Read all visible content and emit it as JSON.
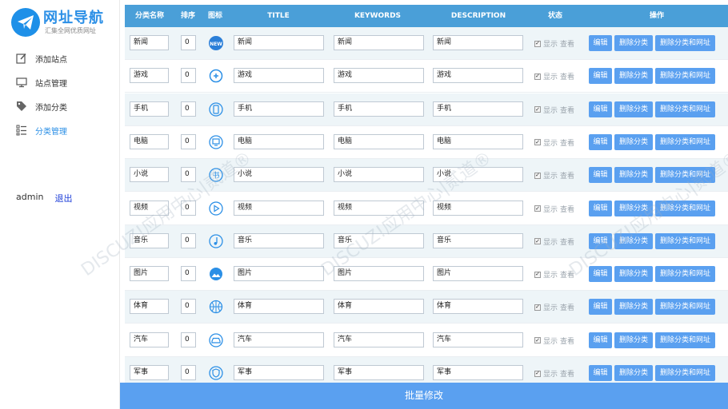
{
  "logo": {
    "title": "网址导航",
    "subtitle": "汇集全网优质网址"
  },
  "menu": [
    {
      "label": "添加站点",
      "icon": "edit-icon"
    },
    {
      "label": "站点管理",
      "icon": "monitor-icon"
    },
    {
      "label": "添加分类",
      "icon": "tag-icon"
    },
    {
      "label": "分类管理",
      "icon": "list-icon"
    }
  ],
  "user": {
    "name": "admin",
    "logout": "退出"
  },
  "table": {
    "headers": [
      "分类名称",
      "排序",
      "图标",
      "TITLE",
      "KEYWORDS",
      "DESCRIPTION",
      "状态",
      "操作"
    ],
    "rows": [
      {
        "name": "新闻",
        "sort": "0",
        "icon": "news-icon",
        "title": "新闻",
        "keywords": "新闻",
        "description": "新闻"
      },
      {
        "name": "游戏",
        "sort": "0",
        "icon": "game-icon",
        "title": "游戏",
        "keywords": "游戏",
        "description": "游戏"
      },
      {
        "name": "手机",
        "sort": "0",
        "icon": "phone-icon",
        "title": "手机",
        "keywords": "手机",
        "description": "手机"
      },
      {
        "name": "电脑",
        "sort": "0",
        "icon": "computer-icon",
        "title": "电脑",
        "keywords": "电脑",
        "description": "电脑"
      },
      {
        "name": "小说",
        "sort": "0",
        "icon": "book-icon",
        "title": "小说",
        "keywords": "小说",
        "description": "小说"
      },
      {
        "name": "视频",
        "sort": "0",
        "icon": "play-icon",
        "title": "视频",
        "keywords": "视频",
        "description": "视频"
      },
      {
        "name": "音乐",
        "sort": "0",
        "icon": "music-icon",
        "title": "音乐",
        "keywords": "音乐",
        "description": "音乐"
      },
      {
        "name": "图片",
        "sort": "0",
        "icon": "picture-icon",
        "title": "图片",
        "keywords": "图片",
        "description": "图片"
      },
      {
        "name": "体育",
        "sort": "0",
        "icon": "basketball-icon",
        "title": "体育",
        "keywords": "体育",
        "description": "体育"
      },
      {
        "name": "汽车",
        "sort": "0",
        "icon": "car-icon",
        "title": "汽车",
        "keywords": "汽车",
        "description": "汽车"
      },
      {
        "name": "军事",
        "sort": "0",
        "icon": "shield-icon",
        "title": "军事",
        "keywords": "军事",
        "description": "军事"
      }
    ],
    "status_show": "显示",
    "status_view": "查看",
    "btn_edit": "编辑",
    "btn_delete_category": "删除分类",
    "btn_delete_all": "删除分类和网址"
  },
  "batch_button": "批量修改",
  "watermarks": [
    "DISCUZ!应用中心|贰道®",
    "addon.dismall.com"
  ],
  "colors": {
    "header": "#4a9fd8",
    "button": "#5aa0f0",
    "accent": "#2b8fe6",
    "logout": "#1e3fd8"
  }
}
